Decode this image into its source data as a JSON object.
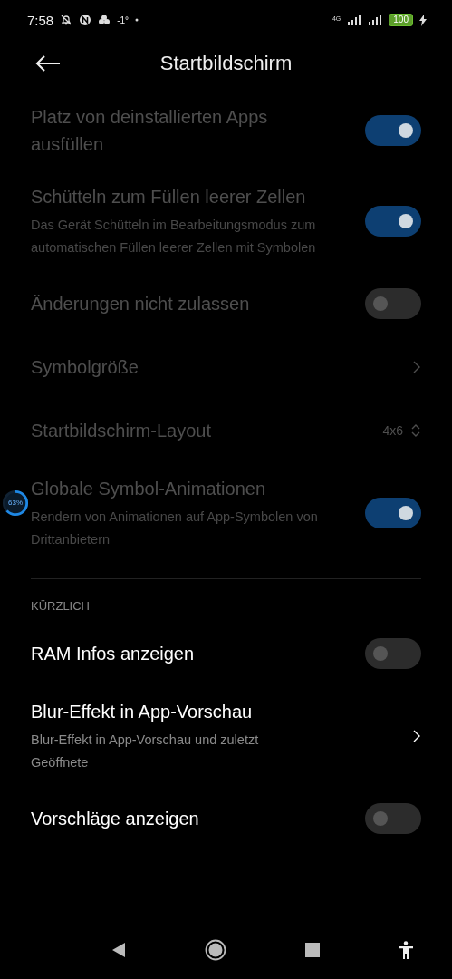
{
  "status_bar": {
    "time": "7:58",
    "temperature": "-1°",
    "network": "4G",
    "battery": "100"
  },
  "header": {
    "title": "Startbildschirm"
  },
  "sections": [
    {
      "items": [
        {
          "kind": "toggle",
          "title": "Platz von deinstallierten Apps ausfüllen",
          "disabled": true,
          "on": true
        },
        {
          "kind": "toggle",
          "title": "Schütteln zum Füllen leerer Zellen",
          "subtitle": "Das Gerät Schütteln im Bearbeitungsmodus zum automatischen Füllen leerer Zellen mit Symbolen",
          "disabled": true,
          "on": true
        },
        {
          "kind": "toggle",
          "title": "Änderungen nicht zulassen",
          "disabled": true,
          "on": false
        },
        {
          "kind": "link",
          "title": "Symbolgröße",
          "disabled": true
        },
        {
          "kind": "stepper",
          "title": "Startbildschirm-Layout",
          "value": "4x6",
          "disabled": true
        },
        {
          "kind": "toggle",
          "title": "Globale Symbol-Animationen",
          "subtitle": "Rendern von Animationen auf App-Symbolen von Drittanbietern",
          "disabled": true,
          "on": true
        }
      ]
    },
    {
      "label": "KÜRZLICH",
      "items": [
        {
          "kind": "toggle",
          "title": "RAM Infos anzeigen",
          "disabled": false,
          "on": false
        },
        {
          "kind": "link",
          "title": "Blur-Effekt in App-Vorschau",
          "subtitle": "Blur-Effekt in App-Vorschau und zuletzt Geöffnete",
          "disabled": false
        },
        {
          "kind": "toggle",
          "title": "Vorschläge anzeigen",
          "disabled": false,
          "on": false
        }
      ]
    }
  ],
  "floating_bubble": {
    "text": "63%",
    "level": 0.63
  }
}
